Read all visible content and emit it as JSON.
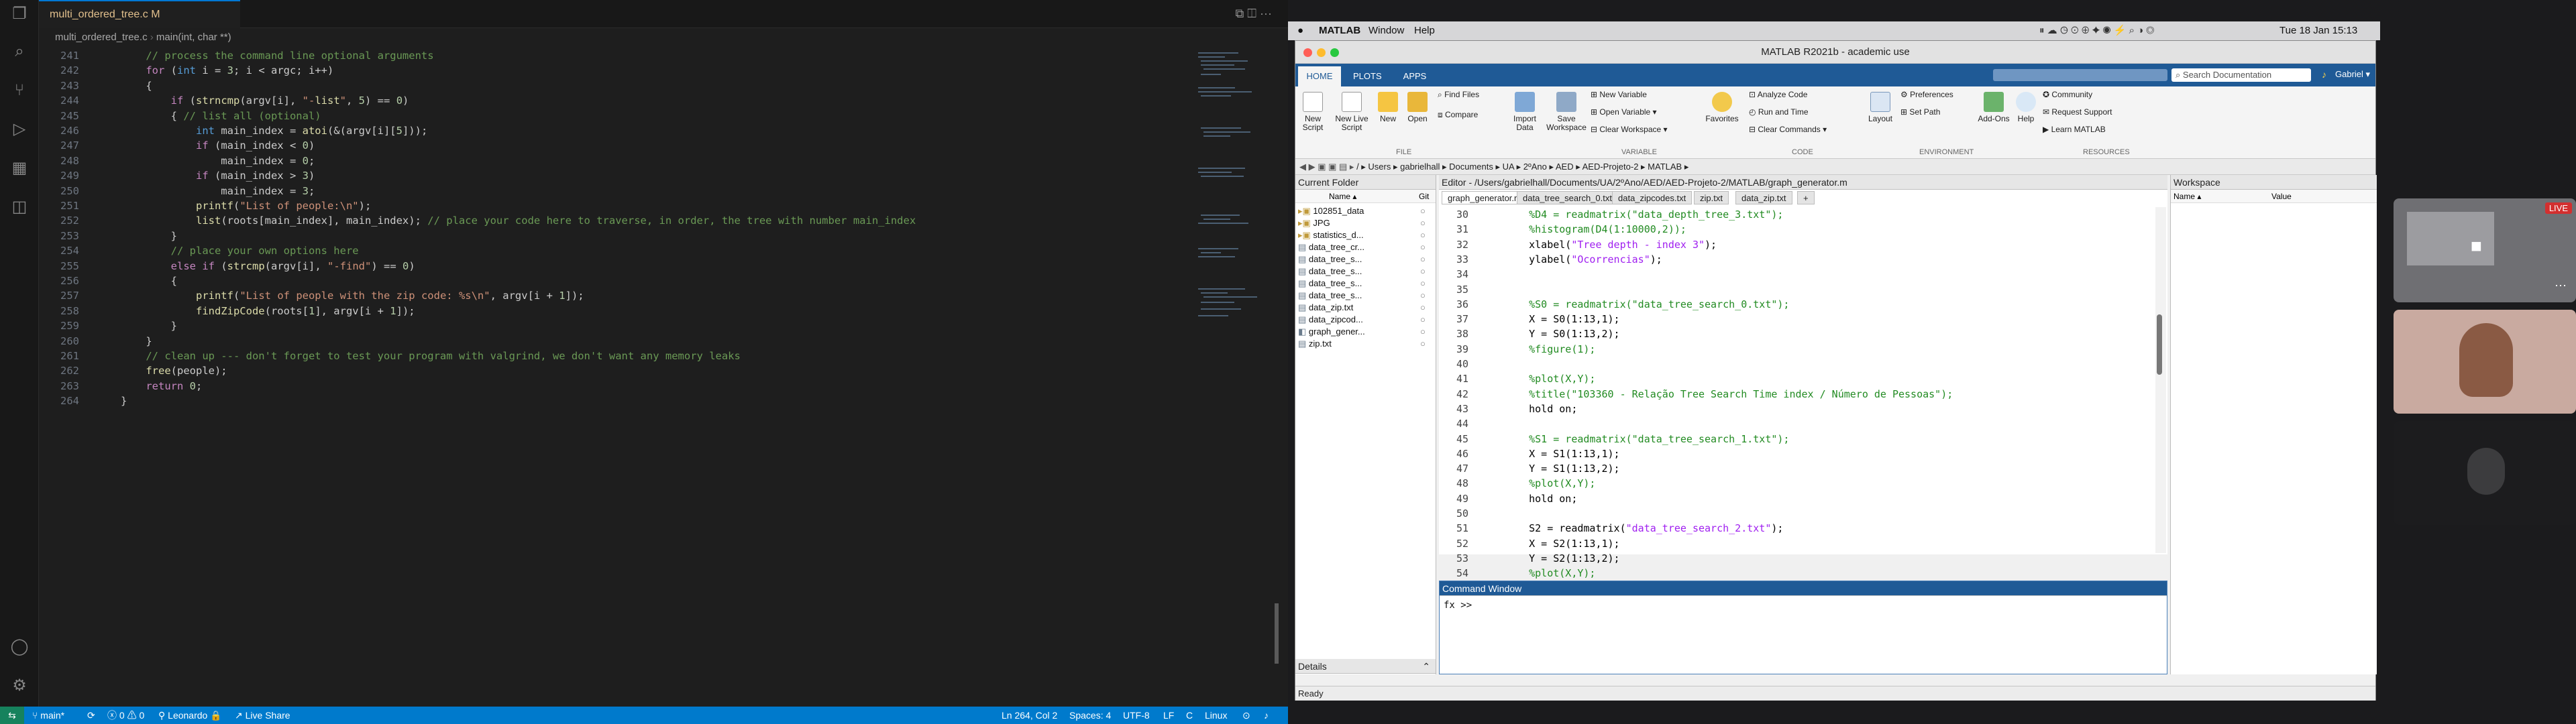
{
  "vscode": {
    "tab": "multi_ordered_tree.c M",
    "breadcrumb_file": "multi_ordered_tree.c",
    "breadcrumb_fn": "main(int, char **)",
    "lines": [
      {
        "n": "241",
        "t": "    // process the command line optional arguments"
      },
      {
        "n": "242",
        "t": "    for (int i = 3; i < argc; i++)"
      },
      {
        "n": "243",
        "t": "    {"
      },
      {
        "n": "244",
        "t": "        if (strncmp(argv[i], \"-list\", 5) == 0)"
      },
      {
        "n": "245",
        "t": "        { // list all (optional)"
      },
      {
        "n": "246",
        "t": "            int main_index = atoi(&(argv[i][5]));"
      },
      {
        "n": "247",
        "t": "            if (main_index < 0)"
      },
      {
        "n": "248",
        "t": "                main_index = 0;"
      },
      {
        "n": "249",
        "t": "            if (main_index > 3)"
      },
      {
        "n": "250",
        "t": "                main_index = 3;"
      },
      {
        "n": "251",
        "t": "            printf(\"List of people:\\n\");"
      },
      {
        "n": "252",
        "t": "            list(roots[main_index], main_index); // place your code here to traverse, in order, the tree with number main_index"
      },
      {
        "n": "253",
        "t": "        }"
      },
      {
        "n": "254",
        "t": "        // place your own options here"
      },
      {
        "n": "255",
        "t": "        else if (strcmp(argv[i], \"-find\") == 0)"
      },
      {
        "n": "256",
        "t": "        {"
      },
      {
        "n": "257",
        "t": "            printf(\"List of people with the zip code: %s\\n\", argv[i + 1]);"
      },
      {
        "n": "258",
        "t": "            findZipCode(roots[1], argv[i + 1]);"
      },
      {
        "n": "259",
        "t": "        }"
      },
      {
        "n": "260",
        "t": "    }"
      },
      {
        "n": "261",
        "t": "    // clean up --- don't forget to test your program with valgrind, we don't want any memory leaks"
      },
      {
        "n": "262",
        "t": "    free(people);"
      },
      {
        "n": "263",
        "t": "    return 0;"
      },
      {
        "n": "264",
        "t": "}"
      }
    ],
    "status": {
      "branch": "main*",
      "problems": "0 ⚠ 0",
      "user": "Leonardo",
      "live_share": "Live Share",
      "position": "Ln 264, Col 2",
      "spaces": "Spaces: 4",
      "encoding": "UTF-8",
      "eol": "LF",
      "lang": "C",
      "os": "Linux"
    }
  },
  "mac": {
    "menu": [
      "MATLAB",
      "Window",
      "Help"
    ],
    "clock": "Tue 18 Jan  15:13"
  },
  "matlab": {
    "title": "MATLAB R2021b - academic use",
    "tabs": [
      "HOME",
      "PLOTS",
      "APPS"
    ],
    "search_placeholder": "Search Documentation",
    "user": "Gabriel",
    "ribbon": {
      "new_script": "New Script",
      "new_live": "New Live Script",
      "new": "New",
      "open": "Open",
      "find_files": "Find Files",
      "compare": "Compare",
      "import": "Import Data",
      "save_ws": "Save Workspace",
      "new_var": "New Variable",
      "open_var": "Open Variable",
      "clear_ws": "Clear Workspace",
      "favorites": "Favorites",
      "analyze": "Analyze Code",
      "run_time": "Run and Time",
      "clear_cmds": "Clear Commands",
      "layout": "Layout",
      "prefs": "Preferences",
      "set_path": "Set Path",
      "addons": "Add-Ons",
      "help": "Help",
      "community": "Community",
      "support": "Request Support",
      "learn": "Learn MATLAB",
      "sections": [
        "FILE",
        "VARIABLE",
        "CODE",
        "ENVIRONMENT",
        "RESOURCES"
      ]
    },
    "path": "/ ▸ Users ▸ gabrielhall ▸ Documents ▸ UA ▸ 2ºAno ▸ AED ▸ AED-Projeto-2 ▸ MATLAB ▸",
    "current_folder": {
      "title": "Current Folder",
      "col_name": "Name ▴",
      "col_git": "Git",
      "items": [
        "102851_data",
        "JPG",
        "statistics_d...",
        "data_tree_cr...",
        "data_tree_s...",
        "data_tree_s...",
        "data_tree_s...",
        "data_tree_s...",
        "data_zip.txt",
        "data_zipcod...",
        "graph_gener...",
        "zip.txt"
      ]
    },
    "details": "Details",
    "editor": {
      "title": "Editor - /Users/gabrielhall/Documents/UA/2ºAno/AED/AED-Projeto-2/MATLAB/graph_generator.m",
      "tabs": [
        "graph_generator.m",
        "data_tree_search_0.txt",
        "data_zipcodes.txt",
        "zip.txt",
        "data_zip.txt"
      ],
      "lines": [
        {
          "n": "30",
          "t": "    %D4 = readmatrix(\"data_depth_tree_3.txt\");"
        },
        {
          "n": "31",
          "t": "    %histogram(D4(1:10000,2));"
        },
        {
          "n": "32",
          "t": "    xlabel(\"Tree depth - index 3\");"
        },
        {
          "n": "33",
          "t": "    ylabel(\"Ocorrencias\");"
        },
        {
          "n": "34",
          "t": ""
        },
        {
          "n": "35",
          "t": ""
        },
        {
          "n": "36",
          "t": "    %S0 = readmatrix(\"data_tree_search_0.txt\");"
        },
        {
          "n": "37",
          "t": "    X = S0(1:13,1);"
        },
        {
          "n": "38",
          "t": "    Y = S0(1:13,2);"
        },
        {
          "n": "39",
          "t": "    %figure(1);"
        },
        {
          "n": "40",
          "t": ""
        },
        {
          "n": "41",
          "t": "    %plot(X,Y);"
        },
        {
          "n": "42",
          "t": "    %title(\"103360 - Relação Tree Search Time index / Número de Pessoas\");"
        },
        {
          "n": "43",
          "t": "    hold on;"
        },
        {
          "n": "44",
          "t": ""
        },
        {
          "n": "45",
          "t": "    %S1 = readmatrix(\"data_tree_search_1.txt\");"
        },
        {
          "n": "46",
          "t": "    X = S1(1:13,1);"
        },
        {
          "n": "47",
          "t": "    Y = S1(1:13,2);"
        },
        {
          "n": "48",
          "t": "    %plot(X,Y);"
        },
        {
          "n": "49",
          "t": "    hold on;"
        },
        {
          "n": "50",
          "t": ""
        },
        {
          "n": "51",
          "t": "    S2 = readmatrix(\"data_tree_search_2.txt\");"
        },
        {
          "n": "52",
          "t": "    X = S2(1:13,1);"
        },
        {
          "n": "53",
          "t": "    Y = S2(1:13,2);"
        },
        {
          "n": "54",
          "t": "    %plot(X,Y);"
        }
      ]
    },
    "command_window": {
      "title": "Command Window",
      "prompt": "fx >>"
    },
    "workspace": {
      "title": "Workspace",
      "col_name": "Name ▴",
      "col_value": "Value"
    },
    "status": "Ready"
  },
  "video": {
    "live": "LIVE"
  }
}
